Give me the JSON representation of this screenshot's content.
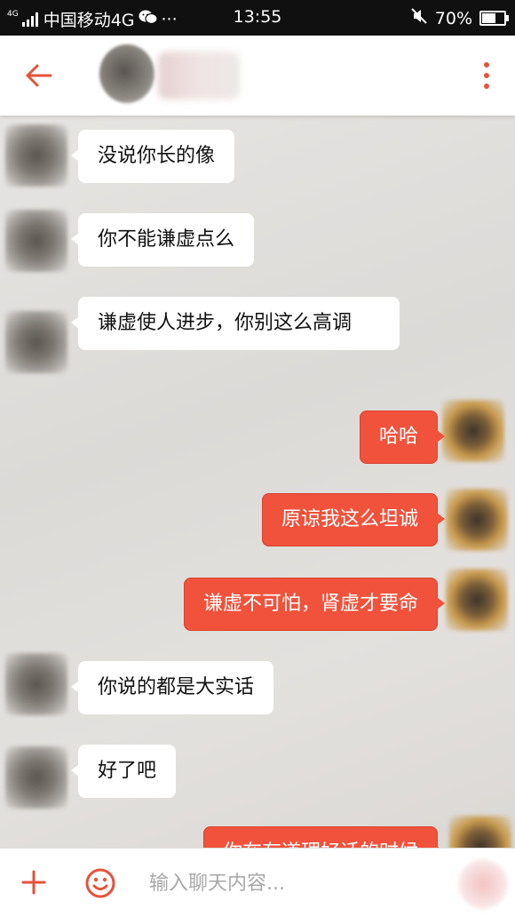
{
  "status_bar": {
    "network_type": "4G",
    "carrier": "中国移动4G",
    "more": "···",
    "time": "13:55",
    "battery": "70%",
    "battery_level": 0.7,
    "icons": [
      "signal-icon",
      "wechat-icon",
      "mute-icon",
      "battery-icon"
    ]
  },
  "header": {
    "back_icon": "arrow-left-icon",
    "menu_icon": "more-vertical-icon",
    "accent_color": "#e5533a"
  },
  "messages": [
    {
      "side": "in",
      "text": "没说你长的像"
    },
    {
      "side": "in",
      "text": "你不能谦虚点么"
    },
    {
      "side": "in",
      "text": "谦虚使人进步，你别这么高调"
    },
    {
      "side": "out",
      "text": "哈哈"
    },
    {
      "side": "out",
      "text": "原谅我这么坦诚"
    },
    {
      "side": "out",
      "text": "谦虚不可怕，肾虚才要命"
    },
    {
      "side": "in",
      "text": "你说的都是大实话"
    },
    {
      "side": "in",
      "text": "好了吧"
    },
    {
      "side": "out",
      "text": "你在有道理好话的时候"
    }
  ],
  "input_bar": {
    "placeholder": "输入聊天内容...",
    "plus_icon": "plus-icon",
    "emoji_icon": "emoji-icon",
    "accent_color": "#e5533a"
  },
  "colors": {
    "outgoing_bubble": "#f0523b",
    "incoming_bubble": "#ffffff"
  }
}
